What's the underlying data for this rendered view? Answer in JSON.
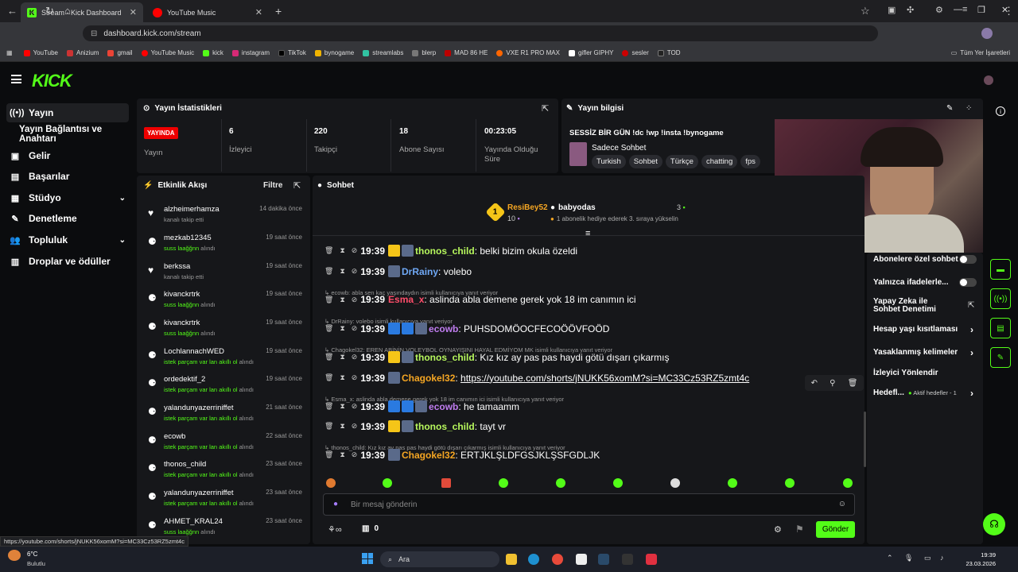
{
  "browser": {
    "tabs": [
      {
        "title": "Stream - Kick Dashboard"
      },
      {
        "title": "YouTube Music"
      }
    ],
    "url": "dashboard.kick.com/stream",
    "bookmarks": [
      "YouTube",
      "Anizium",
      "gmail",
      "YouTube Music",
      "kick",
      "instagram",
      "TikTok",
      "bynogame",
      "streamlabs",
      "blerp",
      "MAD 86 HE",
      "VXE R1 PRO MAX",
      "gifler GIPHY",
      "sesler",
      "TOD"
    ],
    "all_bookmarks": "Tüm Yer İşaretleri",
    "status_url": "https://youtube.com/shorts/jNUKK56xomM?si=MC33Cz53RZ5zmt4c"
  },
  "sidebar": {
    "items": [
      {
        "label": "Yayın"
      },
      {
        "label": "Yayın Bağlantısı ve Anahtarı"
      },
      {
        "label": "Gelir"
      },
      {
        "label": "Başarılar"
      },
      {
        "label": "Stüdyo"
      },
      {
        "label": "Denetleme"
      },
      {
        "label": "Topluluk"
      },
      {
        "label": "Droplar ve ödüller"
      }
    ]
  },
  "stats": {
    "title": "Yayın İstatistikleri",
    "live_badge": "YAYINDA",
    "live_label": "Yayın",
    "items": [
      {
        "value": "6",
        "label": "İzleyici"
      },
      {
        "value": "220",
        "label": "Takipçi"
      },
      {
        "value": "18",
        "label": "Abone Sayısı"
      },
      {
        "value": "00:23:05",
        "label": "Yayında Olduğu Süre"
      }
    ]
  },
  "info": {
    "title": "Yayın bilgisi",
    "stream_title": "SESSİZ BİR GÜN !dc !wp !insta !bynogame",
    "category": "Sadece Sohbet",
    "tags": [
      "Turkish",
      "Sohbet",
      "Türkçe",
      "chatting",
      "fps"
    ]
  },
  "activity": {
    "title": "Etkinlik Akışı",
    "filter": "Filtre",
    "items": [
      {
        "name": "alzheimerhamza",
        "sub": "kanalı takip etti",
        "reward": "",
        "time": "14 dakika önce",
        "icon": "heart"
      },
      {
        "name": "mezkab12345",
        "sub": " alındı",
        "reward": "suss laağğnn",
        "time": "19 saat önce",
        "icon": "points"
      },
      {
        "name": "berkssa",
        "sub": "kanalı takip etti",
        "reward": "",
        "time": "19 saat önce",
        "icon": "heart"
      },
      {
        "name": "kivanckrtrk",
        "sub": " alındı",
        "reward": "suss laağğnn",
        "time": "19 saat önce",
        "icon": "points"
      },
      {
        "name": "kivanckrtrk",
        "sub": " alındı",
        "reward": "suss laağğnn",
        "time": "19 saat önce",
        "icon": "points"
      },
      {
        "name": "LochlannachWED",
        "sub": " alındı",
        "reward": "istek parçam var lan akıllı ol",
        "time": "19 saat önce",
        "icon": "points"
      },
      {
        "name": "ordedektif_2",
        "sub": " alındı",
        "reward": "istek parçam var lan akıllı ol",
        "time": "19 saat önce",
        "icon": "points"
      },
      {
        "name": "yalandunyazerriniffet",
        "sub": " alındı",
        "reward": "istek parçam var lan akıllı ol",
        "time": "21 saat önce",
        "icon": "points"
      },
      {
        "name": "ecowb",
        "sub": " alındı",
        "reward": "istek parçam var lan akıllı ol",
        "time": "22 saat önce",
        "icon": "points"
      },
      {
        "name": "thonos_child",
        "sub": " alındı",
        "reward": "istek parçam var lan akıllı ol",
        "time": "23 saat önce",
        "icon": "points"
      },
      {
        "name": "yalandunyazerriniffet",
        "sub": " alındı",
        "reward": "istek parçam var lan akıllı ol",
        "time": "23 saat önce",
        "icon": "points"
      },
      {
        "name": "AHMET_KRAL24",
        "sub": " alındı",
        "reward": "suss laağğnn",
        "time": "23 saat önce",
        "icon": "points"
      }
    ]
  },
  "chat": {
    "title": "Sohbet",
    "top_gifter": {
      "rank": "1",
      "name": "ResiBey52",
      "count": "10"
    },
    "gift_user": "babyodas",
    "gift_text": "1 abonelik hediye ederek 3. sıraya yükselin",
    "gift_count": "3",
    "messages": [
      {
        "reply": "",
        "time": "19:39",
        "user": "thonos_child",
        "color": "#b7f75d",
        "text": ": belki bizim okula özeldi",
        "link": ""
      },
      {
        "reply": "",
        "time": "19:39",
        "user": "DrRainy",
        "color": "#6fa8f5",
        "text": ": volebo",
        "link": ""
      },
      {
        "reply": "ecowb: abla sen kaç yaşındaydın isimli kullanıcıya yanıt veriyor",
        "time": "19:39",
        "user": "Esma_x",
        "color": "#ff4d6a",
        "text": ": aslinda abla demene gerek yok 18 im canımın ici",
        "link": ""
      },
      {
        "reply": "DrRainy: volebo isimli kullanıcıya yanıt veriyor",
        "time": "19:39",
        "user": "ecowb",
        "color": "#c07df0",
        "text": ": PUHSDOMÖOCFECOÖÖVFOÖD",
        "link": ""
      },
      {
        "reply": "Chagokel32: EREN ABİNİN VOLEYBOL OYNAYIŞINI HAYAL EDMİYOM MK isimli kullanıcıya yanıt veriyor",
        "time": "19:39",
        "user": "thonos_child",
        "color": "#b7f75d",
        "text": ": Kız kız ay pas pas haydi götü dışarı çıkarmış",
        "link": ""
      },
      {
        "reply": "",
        "time": "19:39",
        "user": "Chagokel32",
        "color": "#f5a623",
        "text": ": ",
        "link": "https://youtube.com/shorts/jNUKK56xomM?si=MC33Cz53RZ5zmt4c"
      },
      {
        "reply": "Esma_x: aslinda abla demene gerek yok 18 im canımın ici isimli kullanıcıya yanıt veriyor",
        "time": "19:39",
        "user": "ecowb",
        "color": "#c07df0",
        "text": ": he tamaamm",
        "link": ""
      },
      {
        "reply": "",
        "time": "19:39",
        "user": "thonos_child",
        "color": "#b7f75d",
        "text": ": tayt vr",
        "link": ""
      },
      {
        "reply": "thonos_child: Kız kız ay pas pas haydi götü dışarı çıkarmış isimli kullanıcıya yanıt veriyor",
        "time": "19:39",
        "user": "Chagokel32",
        "color": "#f5a623",
        "text": ": ERTJKLŞLDFGSJKLŞSFGDLJK",
        "link": ""
      }
    ],
    "input_placeholder": "Bir mesaj gönderin",
    "points": "0",
    "send_label": "Gönder"
  },
  "settings": {
    "items": [
      {
        "label": "Abonelere özel sohbet",
        "control": "toggle"
      },
      {
        "label": "Yalnızca ifadelerle...",
        "control": "toggle"
      },
      {
        "label": "Yapay Zeka ile Sohbet Denetimi",
        "control": "link"
      },
      {
        "label": "Hesap yaşı kısıtlaması",
        "control": "chevron"
      },
      {
        "label": "Yasaklanmış kelimeler",
        "control": "chevron"
      },
      {
        "label": "İzleyici Yönlendir",
        "control": ""
      },
      {
        "label": "Hedefl...",
        "control": "chevron"
      }
    ],
    "goals_status": "Aktif hedefler - 1"
  },
  "taskbar": {
    "weather_temp": "6°C",
    "weather_desc": "Bulutlu",
    "search": "Ara",
    "time": "19:39",
    "date": "23.03.2026"
  },
  "colors": {
    "accent": "#53fc18",
    "live": "#e00000"
  }
}
